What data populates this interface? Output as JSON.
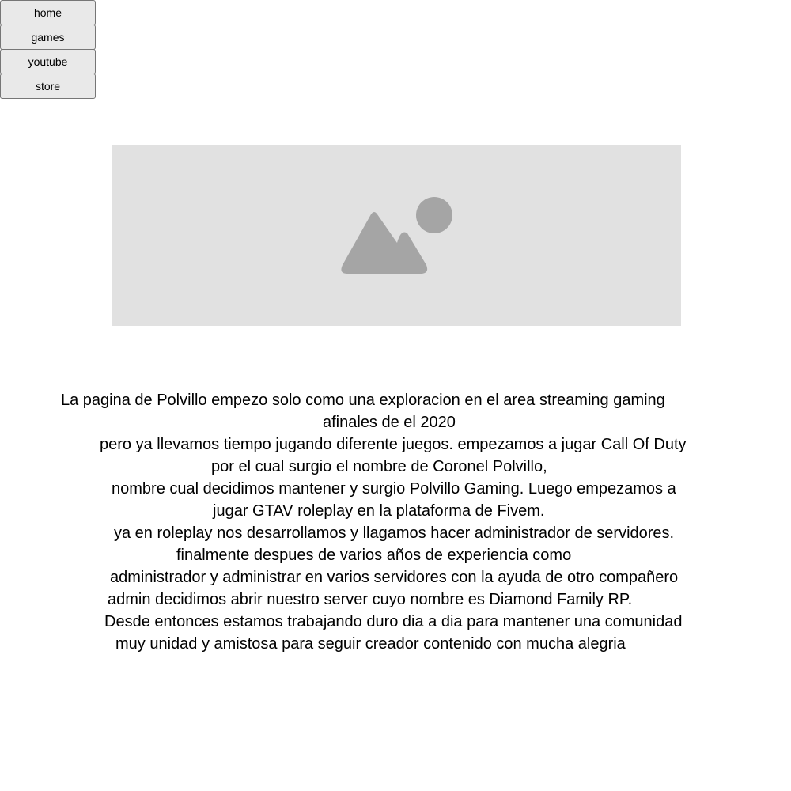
{
  "nav": {
    "items": [
      {
        "label": "home"
      },
      {
        "label": "games"
      },
      {
        "label": "youtube"
      },
      {
        "label": "store"
      }
    ]
  },
  "hero": {
    "icon": "image-placeholder-icon",
    "background_color": "#e1e1e1",
    "icon_color": "#a5a5a5"
  },
  "about": {
    "lines": [
      "La pagina de Polvillo empezo solo como una exploracion en el area streaming gaming",
      "afinales de el 2020",
      "pero ya llevamos tiempo jugando diferente juegos. empezamos a jugar Call Of Duty",
      "por el cual surgio el nombre de Coronel Polvillo,",
      "nombre cual decidimos mantener y surgio Polvillo Gaming. Luego empezamos a",
      "jugar GTAV roleplay en la plataforma de Fivem.",
      "ya en roleplay nos desarrollamos y llagamos hacer administrador de servidores.",
      "finalmente despues de varios años de experiencia como",
      "administrador y administrar en varios servidores con la ayuda de otro compañero",
      "admin decidimos abrir nuestro server cuyo nombre es Diamond Family RP.",
      "Desde entonces estamos trabajando duro dia a dia para mantener una comunidad",
      "muy unidad y amistosa para seguir creador contenido con mucha alegria"
    ]
  }
}
